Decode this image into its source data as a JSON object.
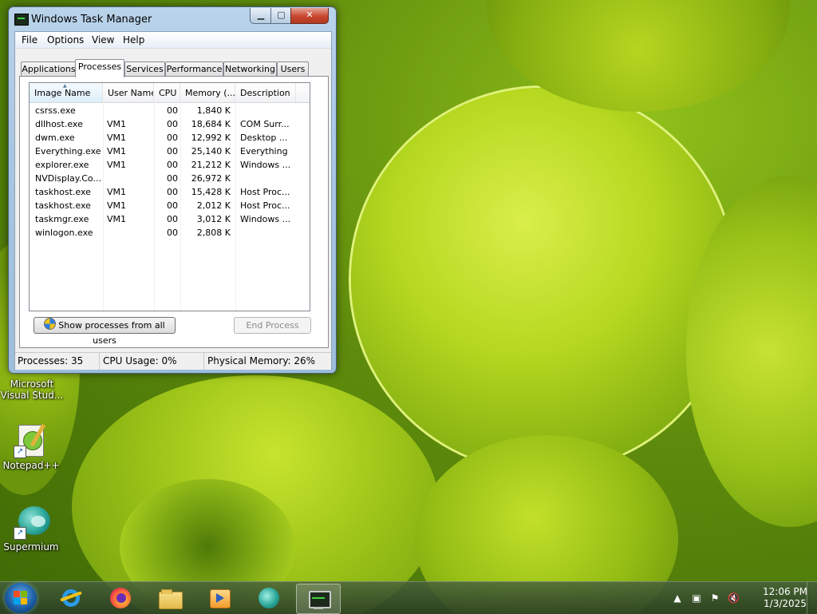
{
  "desktop": {
    "icons": [
      {
        "label": "Microsoft\nVisual Stud...",
        "icon": "visual-studio-icon"
      },
      {
        "label": "Notepad++",
        "icon": "notepad-plus-plus-icon"
      },
      {
        "label": "Supermium",
        "icon": "supermium-icon"
      }
    ]
  },
  "window": {
    "title": "Windows Task Manager",
    "controls": {
      "minimize": "▁",
      "maximize": "▢",
      "close": "✕"
    },
    "menu": [
      "File",
      "Options",
      "View",
      "Help"
    ],
    "tabs": [
      "Applications",
      "Processes",
      "Services",
      "Performance",
      "Networking",
      "Users"
    ],
    "active_tab": "Processes",
    "columns": [
      "Image Name",
      "User Name",
      "CPU",
      "Memory (...",
      "Description"
    ],
    "sorted_column": "Image Name",
    "processes": [
      {
        "name": "csrss.exe",
        "user": "",
        "cpu": "00",
        "memory": "1,840 K",
        "description": ""
      },
      {
        "name": "dllhost.exe",
        "user": "VM1",
        "cpu": "00",
        "memory": "18,684 K",
        "description": "COM Surr..."
      },
      {
        "name": "dwm.exe",
        "user": "VM1",
        "cpu": "00",
        "memory": "12,992 K",
        "description": "Desktop ..."
      },
      {
        "name": "Everything.exe",
        "user": "VM1",
        "cpu": "00",
        "memory": "25,140 K",
        "description": "Everything"
      },
      {
        "name": "explorer.exe",
        "user": "VM1",
        "cpu": "00",
        "memory": "21,212 K",
        "description": "Windows ..."
      },
      {
        "name": "NVDisplay.Co...",
        "user": "",
        "cpu": "00",
        "memory": "26,972 K",
        "description": ""
      },
      {
        "name": "taskhost.exe",
        "user": "VM1",
        "cpu": "00",
        "memory": "15,428 K",
        "description": "Host Proc..."
      },
      {
        "name": "taskhost.exe",
        "user": "VM1",
        "cpu": "00",
        "memory": "2,012 K",
        "description": "Host Proc..."
      },
      {
        "name": "taskmgr.exe",
        "user": "VM1",
        "cpu": "00",
        "memory": "3,012 K",
        "description": "Windows ..."
      },
      {
        "name": "winlogon.exe",
        "user": "",
        "cpu": "00",
        "memory": "2,808 K",
        "description": ""
      }
    ],
    "buttons": {
      "show_all": "Show processes from all users",
      "end_process": "End Process"
    },
    "status": {
      "processes": "Processes: 35",
      "cpu": "CPU Usage: 0%",
      "memory": "Physical Memory: 26%"
    }
  },
  "taskbar": {
    "items": [
      {
        "name": "internet-explorer",
        "icon": "internet-explorer-icon",
        "active": false
      },
      {
        "name": "firefox",
        "icon": "firefox-icon",
        "active": false
      },
      {
        "name": "file-explorer",
        "icon": "folder-icon",
        "active": false
      },
      {
        "name": "media-player",
        "icon": "media-player-icon",
        "active": false
      },
      {
        "name": "supermium",
        "icon": "supermium-icon",
        "active": false
      },
      {
        "name": "task-manager",
        "icon": "task-manager-icon",
        "active": true
      }
    ],
    "clock": {
      "time": "12:06 PM",
      "date": "1/3/2025"
    },
    "tray": [
      "show-hidden-icons-arrow",
      "network-icon",
      "action-center-flag-icon",
      "volume-muted-icon"
    ]
  },
  "colors": {
    "accent": "#1d5fa6",
    "close_button": "#c7462f",
    "wallpaper_green": "#8fbf1a"
  }
}
